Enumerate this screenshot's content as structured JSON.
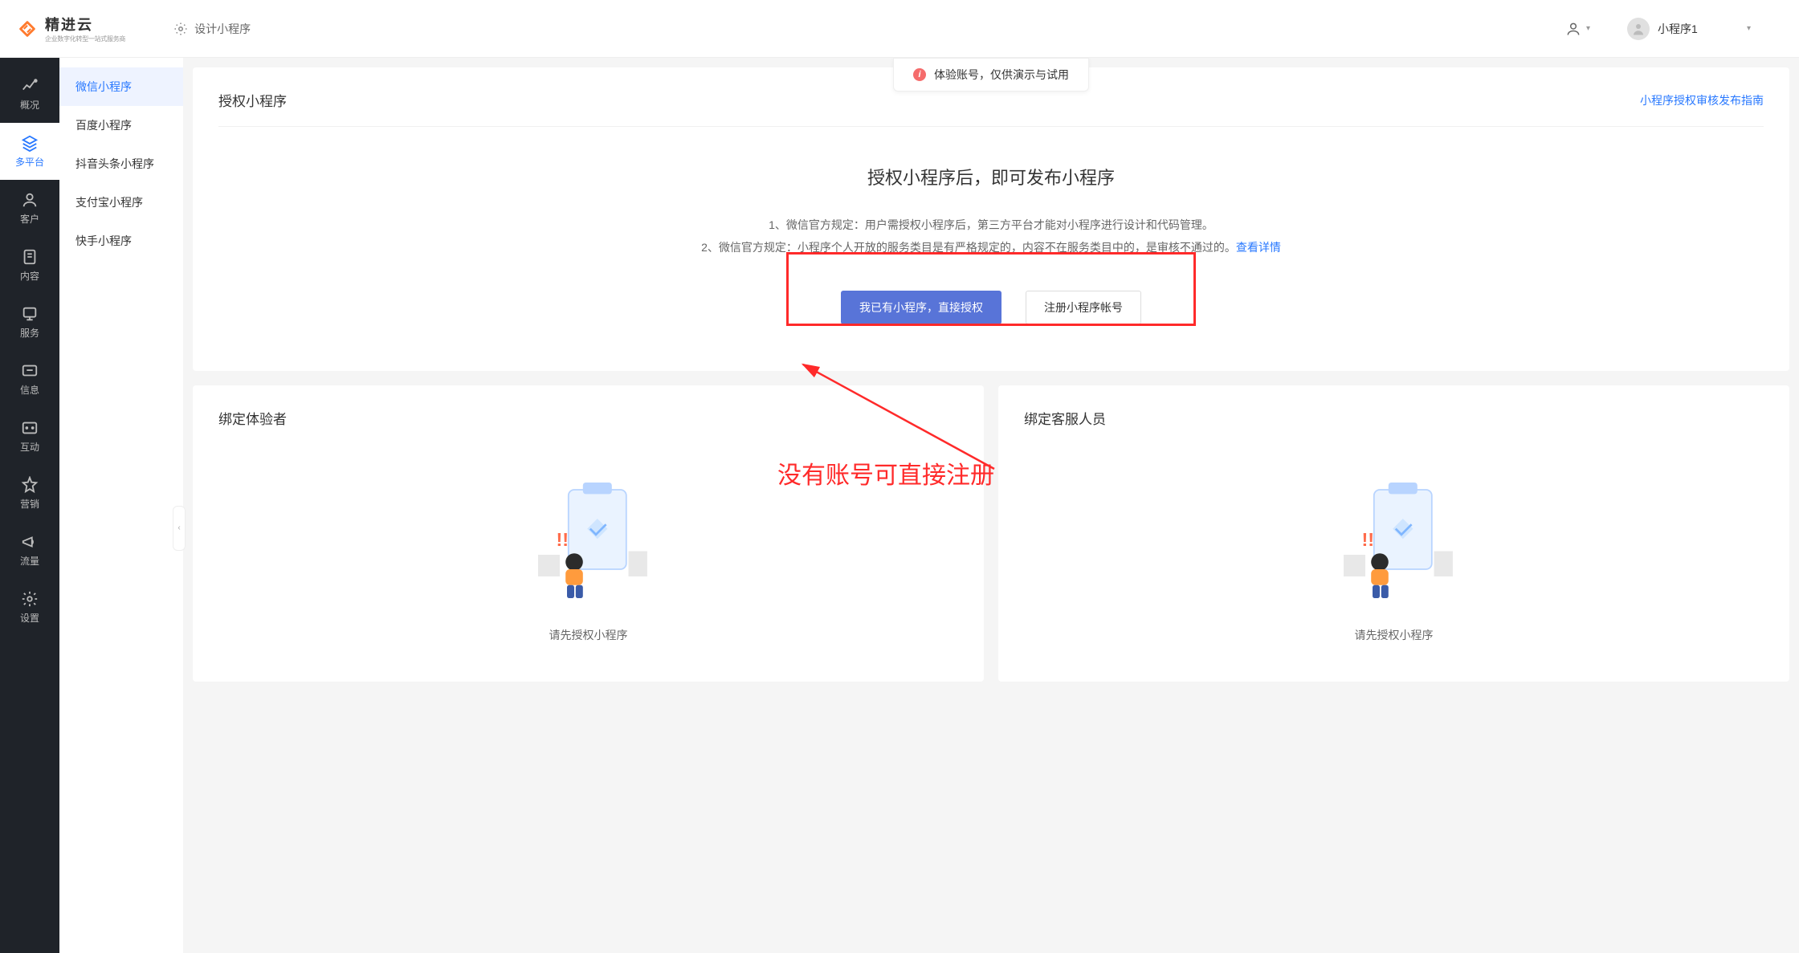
{
  "header": {
    "logo_title": "精进云",
    "logo_sub": "企业数字化转型一站式服务商",
    "design_link": "设计小程序",
    "program_selected": "小程序1"
  },
  "notice": "体验账号，仅供演示与试用",
  "nav_rail": [
    {
      "label": "概况",
      "icon": "chart"
    },
    {
      "label": "多平台",
      "icon": "layers",
      "active": true
    },
    {
      "label": "客户",
      "icon": "user"
    },
    {
      "label": "内容",
      "icon": "file"
    },
    {
      "label": "服务",
      "icon": "service"
    },
    {
      "label": "信息",
      "icon": "message"
    },
    {
      "label": "互动",
      "icon": "interact"
    },
    {
      "label": "营销",
      "icon": "tag"
    },
    {
      "label": "流量",
      "icon": "megaphone"
    },
    {
      "label": "设置",
      "icon": "settings"
    }
  ],
  "sub_sidebar": [
    {
      "label": "微信小程序",
      "active": true
    },
    {
      "label": "百度小程序"
    },
    {
      "label": "抖音头条小程序"
    },
    {
      "label": "支付宝小程序"
    },
    {
      "label": "快手小程序"
    }
  ],
  "auth_card": {
    "title": "授权小程序",
    "guide_link": "小程序授权审核发布指南",
    "heading": "授权小程序后，即可发布小程序",
    "rule1_prefix": "1、微信官方规定：",
    "rule1_text": "用户需授权小程序后，第三方平台才能对小程序进行设计和代码管理。",
    "rule2_prefix": "2、微信官方规定：",
    "rule2_text": "小程序个人开放的服务类目是有严格规定的，内容不在服务类目中的，是审核不通过的。",
    "see_more": "查看详情",
    "btn_primary": "我已有小程序，直接授权",
    "btn_default": "注册小程序帐号"
  },
  "bind_cards": {
    "left_title": "绑定体验者",
    "right_title": "绑定客服人员",
    "placeholder_text": "请先授权小程序"
  },
  "annotation": {
    "text": "没有账号可直接注册"
  }
}
